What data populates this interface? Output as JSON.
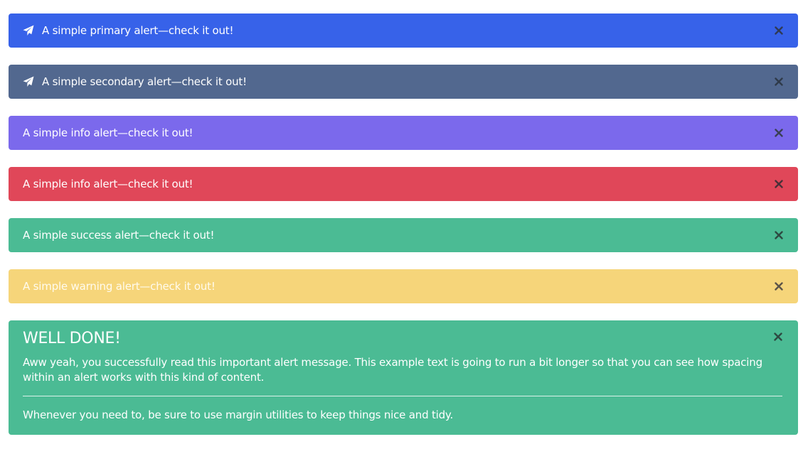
{
  "alerts": [
    {
      "text": "A simple primary alert—check it out!",
      "icon": "paper-plane-icon",
      "color": "#3762e9"
    },
    {
      "text": "A simple secondary alert—check it out!",
      "icon": "paper-plane-icon",
      "color": "#52688f"
    },
    {
      "text": "A simple info alert—check it out!",
      "color": "#7b69ec"
    },
    {
      "text": "A simple info alert—check it out!",
      "color": "#e04759"
    },
    {
      "text": "A simple success alert—check it out!",
      "color": "#4bbb94"
    },
    {
      "text": "A simple warning alert—check it out!",
      "color": "#f6d57a"
    }
  ],
  "block_alert": {
    "heading": "WELL DONE!",
    "body": "Aww yeah, you successfully read this important alert message. This example text is going to run a bit longer so that you can see how spacing within an alert works with this kind of content.",
    "footer": "Whenever you need to, be sure to use margin utilities to keep things nice and tidy.",
    "color": "#4bbb94"
  },
  "close_icon_color": "#3a3f4a"
}
